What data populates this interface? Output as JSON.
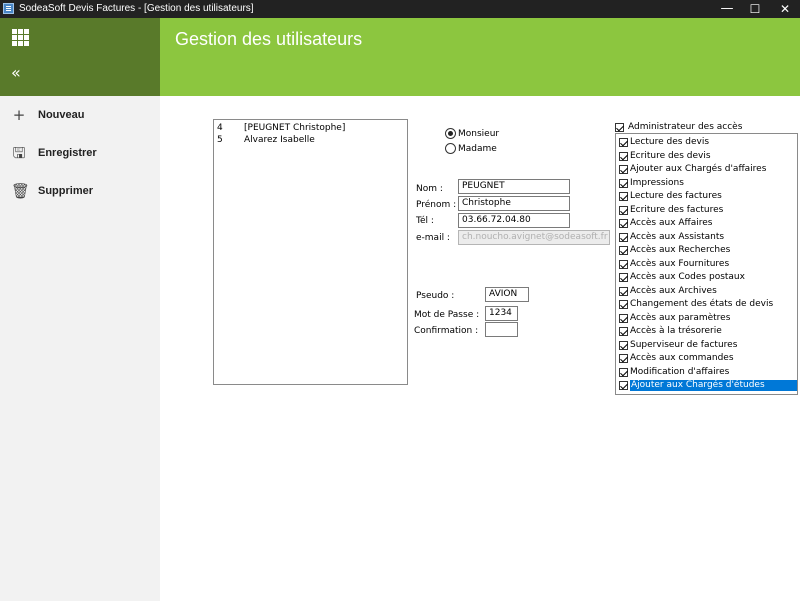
{
  "window": {
    "title": "SodeaSoft Devis Factures - [Gestion des utilisateurs]",
    "minimize": "—",
    "maximize": "☐",
    "close": "✕"
  },
  "header": {
    "title": "Gestion des utilisateurs"
  },
  "sidebar": {
    "collapse_icon": "«",
    "items": [
      {
        "label": "Nouveau",
        "icon": "plus-icon",
        "glyph": "+"
      },
      {
        "label": "Enregistrer",
        "icon": "save-icon",
        "glyph": "🖫"
      },
      {
        "label": "Supprimer",
        "icon": "trash-icon",
        "glyph": "🗑"
      }
    ]
  },
  "users": [
    {
      "id": "4",
      "name": "[PEUGNET Christophe]"
    },
    {
      "id": "5",
      "name": "Alvarez Isabelle"
    }
  ],
  "civility": {
    "options": [
      "Monsieur",
      "Madame"
    ],
    "selected": "Monsieur"
  },
  "form": {
    "nom_label": "Nom :",
    "nom": "PEUGNET",
    "prenom_label": "Prénom :",
    "prenom": "Christophe",
    "tel_label": "Tél :",
    "tel": "03.66.72.04.80",
    "email_label": "e-mail :",
    "email": "ch.noucho.avignet@sodeasoft.fr",
    "pseudo_label": "Pseudo :",
    "pseudo": "AVION",
    "password_label": "Mot de Passe :",
    "password": "1234",
    "confirm_label": "Confirmation :",
    "confirm": ""
  },
  "rights": {
    "admin_label": "Administrateur des accès",
    "admin_checked": true,
    "items": [
      {
        "label": "Lecture des devis",
        "checked": true
      },
      {
        "label": "Ecriture des devis",
        "checked": true
      },
      {
        "label": "Ajouter aux Chargés d'affaires",
        "checked": true
      },
      {
        "label": "Impressions",
        "checked": true
      },
      {
        "label": "Lecture des factures",
        "checked": true
      },
      {
        "label": "Ecriture des factures",
        "checked": true
      },
      {
        "label": "Accès aux Affaires",
        "checked": true
      },
      {
        "label": "Accès aux Assistants",
        "checked": true
      },
      {
        "label": "Accès aux Recherches",
        "checked": true
      },
      {
        "label": "Accès aux Fournitures",
        "checked": true
      },
      {
        "label": "Accès aux Codes postaux",
        "checked": true
      },
      {
        "label": "Accès aux Archives",
        "checked": true
      },
      {
        "label": "Changement des états de devis",
        "checked": true
      },
      {
        "label": "Accès aux paramètres",
        "checked": true
      },
      {
        "label": "Accès à la trésorerie",
        "checked": true
      },
      {
        "label": "Superviseur de factures",
        "checked": true
      },
      {
        "label": "Accès aux commandes",
        "checked": true
      },
      {
        "label": "Modification d'affaires",
        "checked": true
      },
      {
        "label": "Ajouter aux Chargés d'études",
        "checked": true,
        "selected": true
      }
    ]
  },
  "colors": {
    "header": "#8cc63f",
    "sidebar_top": "#597a2a",
    "sidebar": "#f2f2f2",
    "selection": "#0078d7"
  }
}
